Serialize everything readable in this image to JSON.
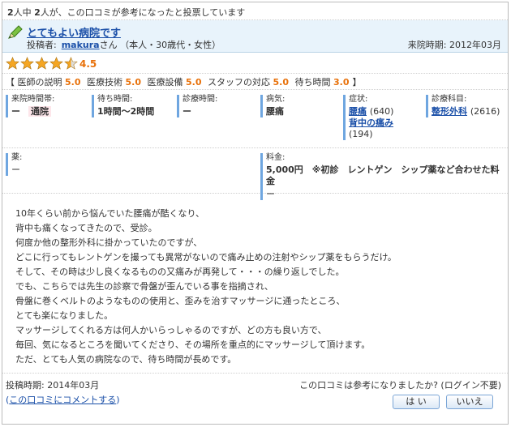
{
  "vote": {
    "total_prefix": "2",
    "total_mid": "人中 ",
    "count": "2",
    "suffix": "人が、この口コミが参考になったと投票しています"
  },
  "title": {
    "text": "とてもよい病院です",
    "poster_label": "投稿者:",
    "author": "makura",
    "author_suffix": "さん （本人・30歳代・女性）",
    "visit": "来院時期: 2012年03月",
    "icon": "pencil-icon"
  },
  "rating": {
    "score": "4.5",
    "stars_value": 4.5,
    "stars_max": 5,
    "star_color": "#f5a623"
  },
  "scores": [
    {
      "label": "医師の説明",
      "value": "5.0"
    },
    {
      "label": "医療技術",
      "value": "5.0"
    },
    {
      "label": "医療設備",
      "value": "5.0"
    },
    {
      "label": "スタッフの対応",
      "value": "5.0"
    },
    {
      "label": "待ち時間",
      "value": "3.0"
    }
  ],
  "scores_open": "【",
  "scores_close": "】",
  "info": {
    "visit_type_label": "来院時間帯:",
    "visit_type_value": "ー",
    "visit_type_tag": "通院",
    "wait_label": "待ち時間:",
    "wait_value": "1時間〜2時間",
    "time_label": "診療時間:",
    "time_value": "ー",
    "disease_label": "病気:",
    "disease_value": "腰痛",
    "symptom_label": "症状:",
    "symptom1": "腰痛",
    "symptom1_count": "(640)",
    "symptom2": "背中の痛み",
    "symptom2_count": "(194)",
    "dept_label": "診療科目:",
    "dept_value": "整形外科",
    "dept_count": "(2616)",
    "medicine_label": "薬:",
    "medicine_value": "ー",
    "fee_label": "料金:",
    "fee_value": "5,000円　※初診　レントゲン　シップ薬など合わせた料金",
    "fee_extra": "ー"
  },
  "body_lines": [
    "10年くらい前から悩んでいた腰痛が酷くなり、",
    "背中も痛くなってきたので、受診。",
    "何度か他の整形外科に掛かっていたのですが、",
    "どこに行ってもレントゲンを撮っても異常がないので痛み止めの注射やシップ薬をもらうだけ。",
    "そして、その時は少し良くなるものの又痛みが再発して・・・の繰り返しでした。",
    "でも、こちらでは先生の診察で骨盤が歪んでいる事を指摘され、",
    "骨盤に巻くベルトのようなものの使用と、歪みを治すマッサージに通ったところ、",
    "とても楽になりました。",
    "マッサージしてくれる方は何人かいらっしゃるのですが、どの方も良い方で、",
    "毎回、気になるところを聞いてくださり、その場所を重点的にマッサージして頂けます。",
    "ただ、とても人気の病院なので、待ち時間が長めです。"
  ],
  "footer": {
    "post_date": "投稿時期: 2014年03月",
    "comment_open": "(",
    "comment_link": "この口コミにコメントする",
    "comment_close": ")",
    "helpful_question": "この口コミは参考になりましたか? (ログイン不要)",
    "yes": "は い",
    "no": "いいえ"
  }
}
